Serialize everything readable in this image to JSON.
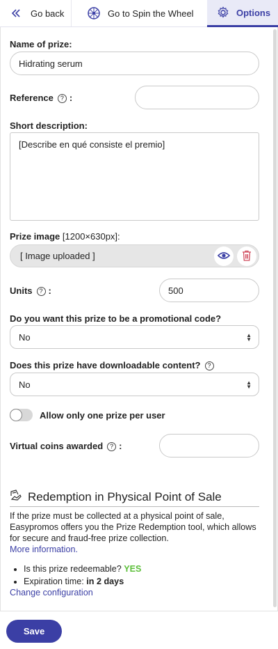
{
  "topbar": {
    "back_label": "Go back",
    "spin_label": "Go to Spin the Wheel",
    "options_label": "Options",
    "accent": "#3b3fa5"
  },
  "form": {
    "prize_name": {
      "label": "Name of prize:",
      "value": "Hidrating serum"
    },
    "reference": {
      "label": "Reference",
      "colon": ":",
      "value": ""
    },
    "short_description": {
      "label": "Short description:",
      "value": "[Describe en qué consiste el premio]"
    },
    "prize_image": {
      "label": "Prize image",
      "size_hint": "[1200×630px]:",
      "value": "[ Image uploaded ]",
      "view_icon": "eye-icon",
      "delete_icon": "trash-icon"
    },
    "units": {
      "label": "Units",
      "colon": ":",
      "value": "500"
    },
    "promo_code": {
      "label": "Do you want this prize to be a promotional code?",
      "value": "No"
    },
    "downloadable": {
      "label": "Does this prize have downloadable content?",
      "value": "No"
    },
    "one_per_user": {
      "label": "Allow only one prize per user",
      "enabled": false
    },
    "virtual_coins": {
      "label": "Virtual coins awarded",
      "colon": ":",
      "value": ""
    }
  },
  "redemption": {
    "title": "Redemption in Physical Point of Sale",
    "description": "If the prize must be collected at a physical point of sale, Easypromos offers you the Prize Redemption tool, which allows for secure and fraud-free prize collection.",
    "more_info_link": "More information.",
    "redeemable_label": "Is this prize redeemable?",
    "redeemable_value": "YES",
    "expiration_label": "Expiration time:",
    "expiration_value": "in 2 days",
    "change_link": "Change configuration"
  },
  "footer": {
    "save_label": "Save"
  }
}
